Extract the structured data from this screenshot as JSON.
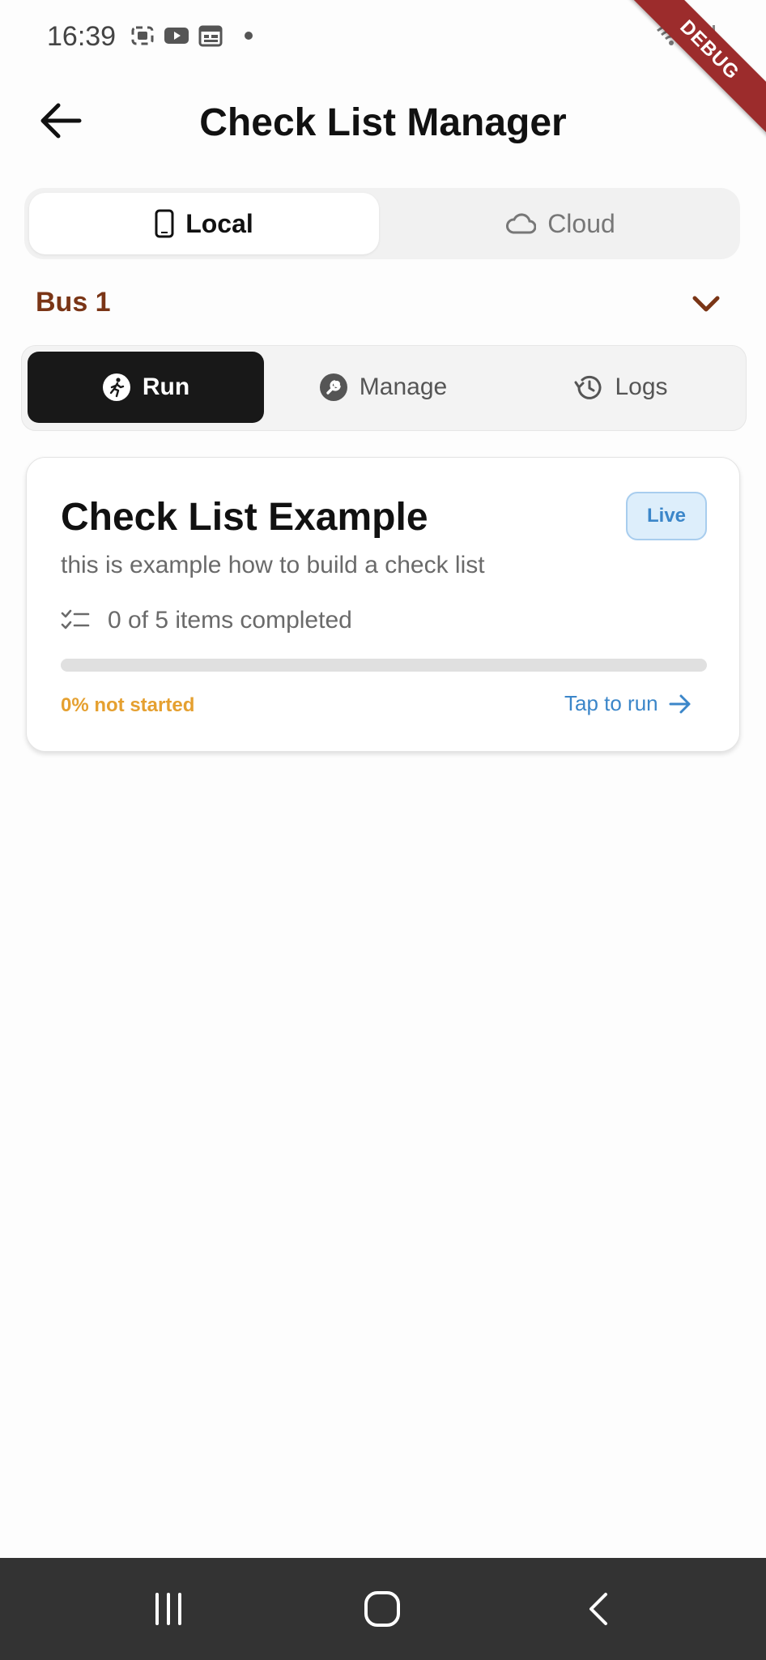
{
  "status_bar": {
    "time": "16:39",
    "icons": [
      "screenshot-icon",
      "youtube-icon",
      "calendar-icon",
      "notification-dot",
      "wifi-icon",
      "signal-icon"
    ],
    "debug_banner": "DEBUG"
  },
  "app_bar": {
    "title": "Check List Manager",
    "back_icon": "arrow-back-icon"
  },
  "storage_toggle": {
    "options": [
      {
        "label": "Local",
        "icon": "phone-icon",
        "selected": true
      },
      {
        "label": "Cloud",
        "icon": "cloud-icon",
        "selected": false
      }
    ]
  },
  "group_selector": {
    "selected": "Bus 1",
    "icon": "chevron-down-icon"
  },
  "mode_tabs": [
    {
      "label": "Run",
      "icon": "run-icon",
      "selected": true
    },
    {
      "label": "Manage",
      "icon": "wrench-icon",
      "selected": false
    },
    {
      "label": "Logs",
      "icon": "history-icon",
      "selected": false
    }
  ],
  "checklists": [
    {
      "title": "Check List Example",
      "badge": "Live",
      "description": "this is example how to build a check list",
      "items_text": "0 of 5 items completed",
      "completed": 0,
      "total": 5,
      "progress_fraction": 0,
      "status": "0% not started",
      "action": "Tap to run"
    }
  ],
  "colors": {
    "accent_brown": "#7a3516",
    "status_orange": "#e5a030",
    "link_blue": "#3b86c9",
    "selected_dark": "#181818"
  },
  "nav_bar": [
    "recents-icon",
    "home-icon",
    "back-icon"
  ]
}
